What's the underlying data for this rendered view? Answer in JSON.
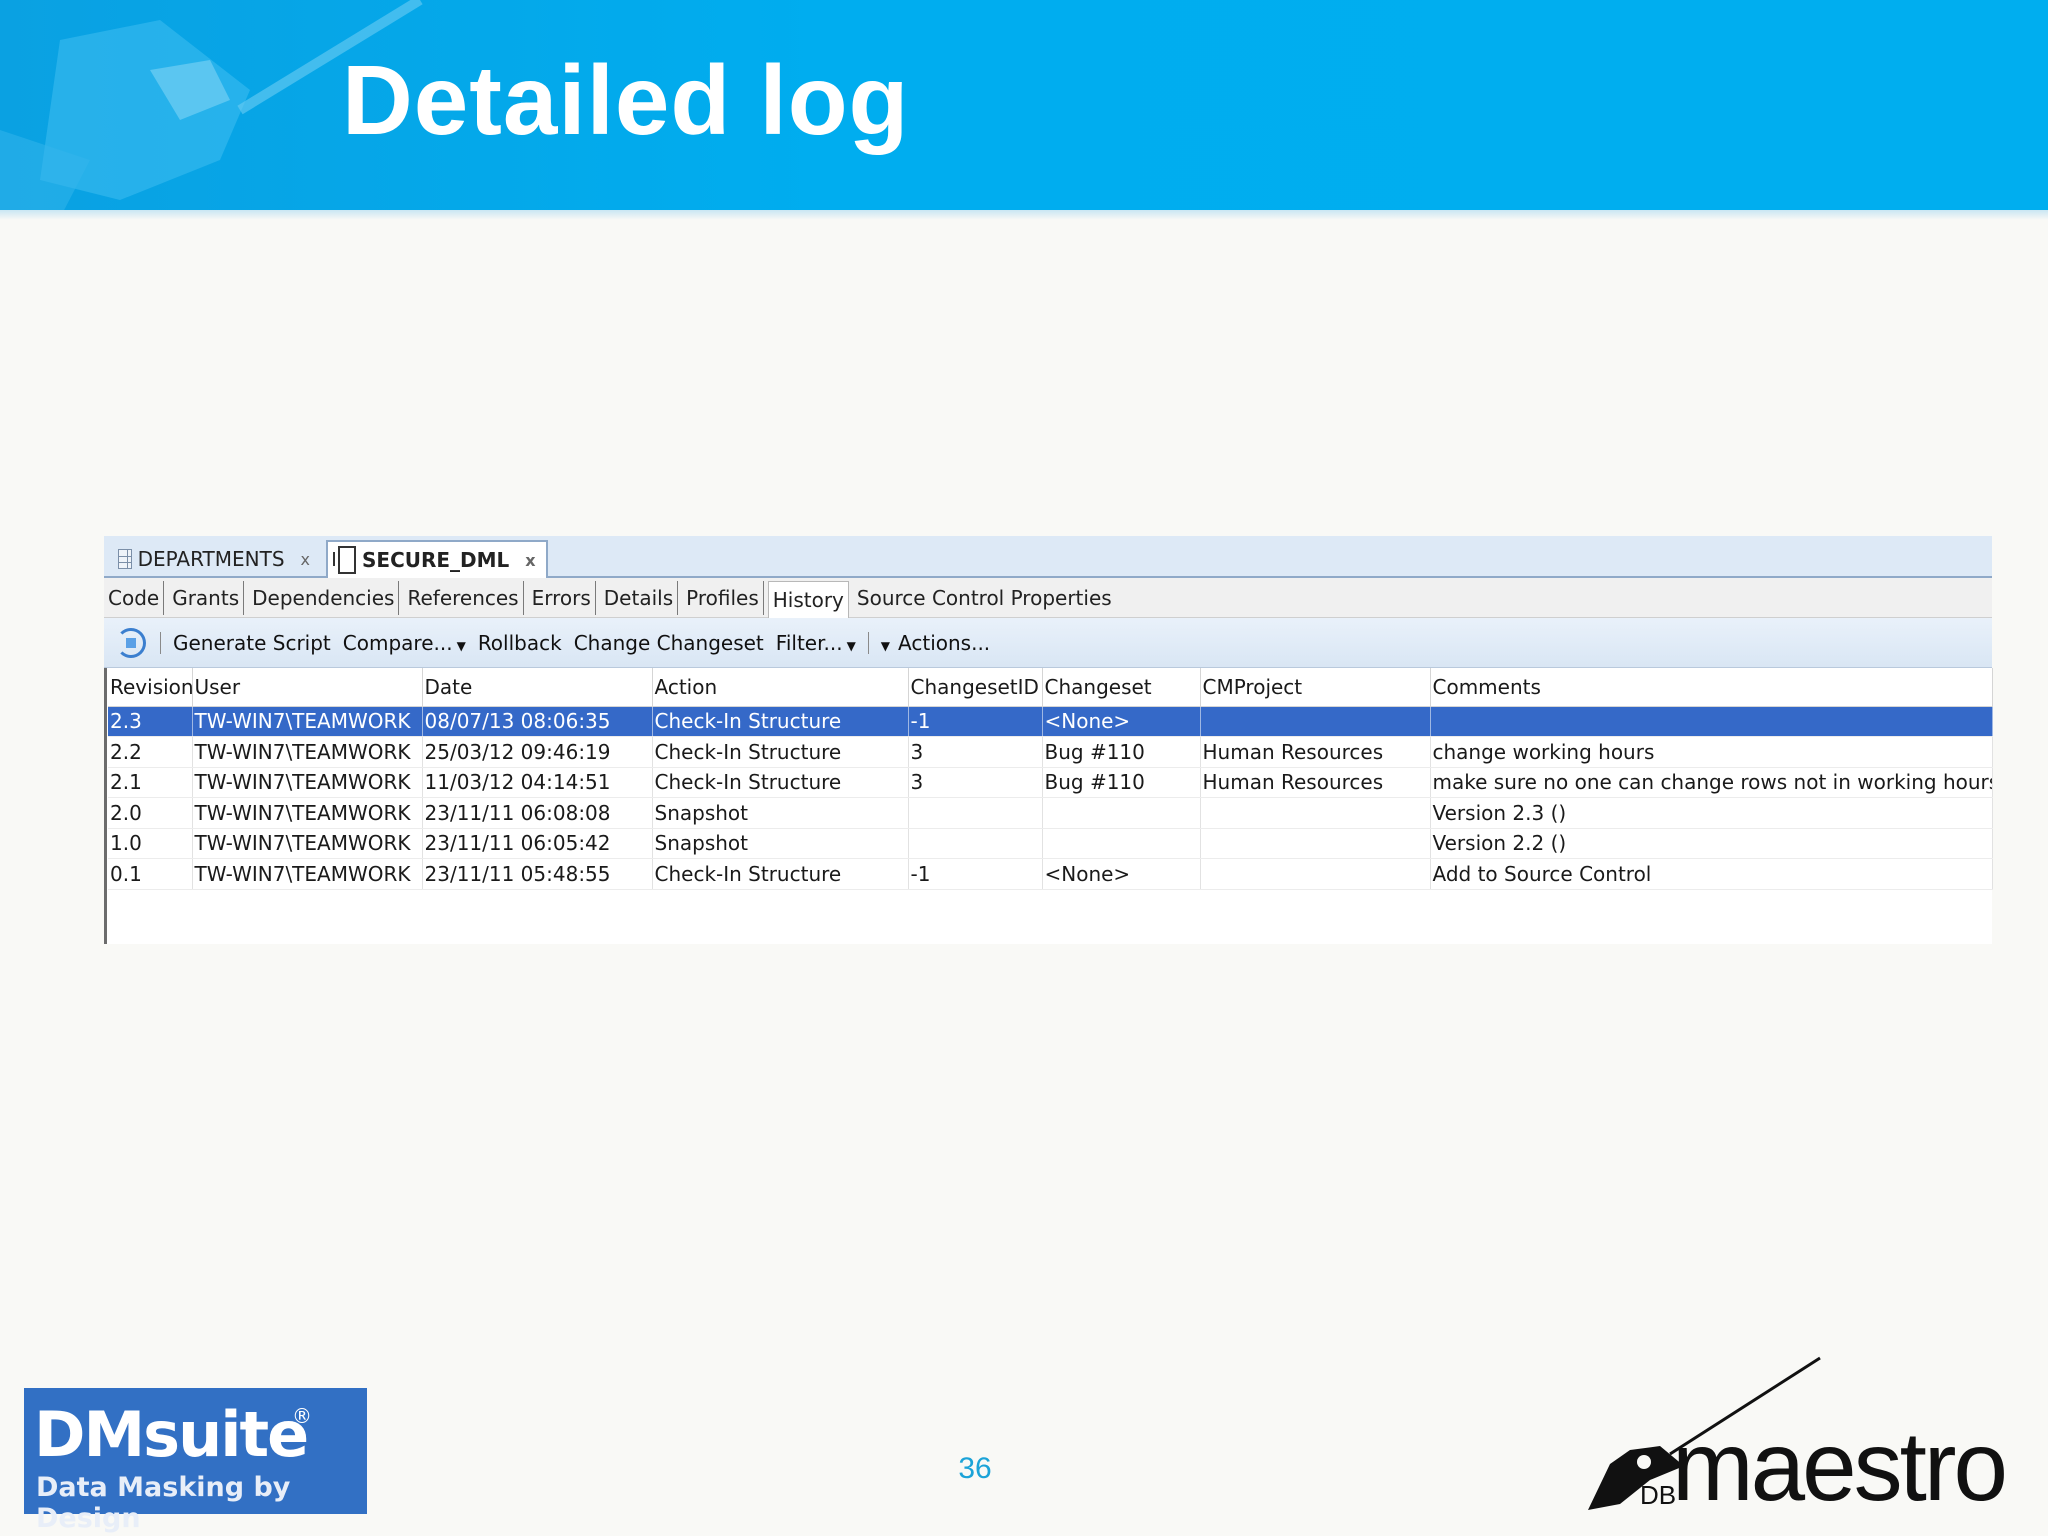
{
  "slide": {
    "title": "Detailed log",
    "page_number": "36"
  },
  "editor_tabs": [
    {
      "label": "DEPARTMENTS",
      "close": "x",
      "icon": "table-grid-icon"
    },
    {
      "label": "SECURE_DML",
      "close": "x",
      "icon": "procedure-icon",
      "active": true
    }
  ],
  "sub_tabs": [
    "Code",
    "Grants",
    "Dependencies",
    "References",
    "Errors",
    "Details",
    "Profiles",
    "History",
    "Source Control Properties"
  ],
  "active_sub_tab": "History",
  "toolbar": {
    "refresh_icon": "refresh-icon",
    "generate_script": "Generate Script",
    "compare": "Compare...",
    "rollback": "Rollback",
    "change_changeset": "Change Changeset",
    "filter": "Filter...",
    "actions": "Actions..."
  },
  "history_table": {
    "columns": [
      "Revision",
      "User",
      "Date",
      "Action",
      "ChangesetID",
      "Changeset",
      "CMProject",
      "Comments"
    ],
    "rows": [
      [
        "2.3",
        "TW-WIN7\\TEAMWORK",
        "08/07/13 08:06:35",
        "Check-In Structure",
        "-1",
        "<None>",
        "",
        ""
      ],
      [
        "2.2",
        "TW-WIN7\\TEAMWORK",
        "25/03/12 09:46:19",
        "Check-In Structure",
        "3",
        "Bug #110",
        "Human Resources",
        "change working hours"
      ],
      [
        "2.1",
        "TW-WIN7\\TEAMWORK",
        "11/03/12 04:14:51",
        "Check-In Structure",
        "3",
        "Bug #110",
        "Human Resources",
        "make sure no one can change rows not in working hours"
      ],
      [
        "2.0",
        "TW-WIN7\\TEAMWORK",
        "23/11/11 06:08:08",
        "Snapshot",
        "",
        "",
        "",
        "Version 2.3 ()"
      ],
      [
        "1.0",
        "TW-WIN7\\TEAMWORK",
        "23/11/11 06:05:42",
        "Snapshot",
        "",
        "",
        "",
        "Version 2.2 ()"
      ],
      [
        "0.1",
        "TW-WIN7\\TEAMWORK",
        "23/11/11 05:48:55",
        "Check-In Structure",
        "-1",
        "<None>",
        "",
        "Add to Source Control"
      ]
    ],
    "selected_row": 0
  },
  "logos": {
    "dmsuite_name": "DMsuite",
    "dmsuite_reg": "®",
    "dmsuite_tagline": "Data Masking by Design",
    "maestro_word": "maestro",
    "maestro_db": "DB"
  },
  "colors": {
    "banner": "#00aeef",
    "selection": "#3569c8",
    "page_number": "#1ca3d8",
    "dmsuite_bg": "#3270c4"
  }
}
